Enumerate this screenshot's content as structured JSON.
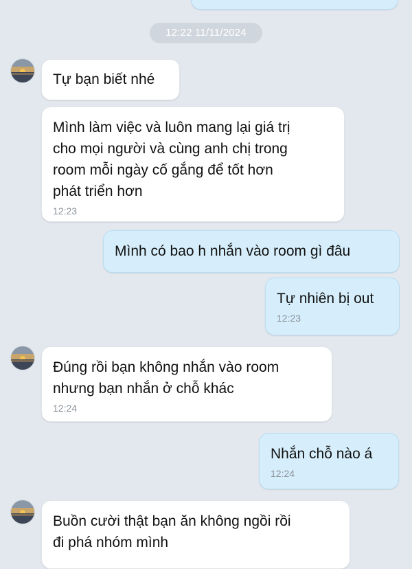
{
  "date_divider": "12:22 11/11/2024",
  "colors": {
    "background": "#e3e8ef",
    "incoming_bubble": "#ffffff",
    "outgoing_bubble": "#d6eefb",
    "timestamp": "#8c939b"
  },
  "messages": [
    {
      "direction": "incoming",
      "text": "Tự bạn biết nhé",
      "time": ""
    },
    {
      "direction": "incoming",
      "text": "Mình làm việc và luôn mang lại giá trị\ncho mọi người và cùng anh chị trong\nroom mỗi ngày cố gắng để tốt hơn\nphát triển hơn",
      "time": "12:23"
    },
    {
      "direction": "outgoing",
      "text": "Mình có bao h nhắn vào room gì đâu",
      "time": ""
    },
    {
      "direction": "outgoing",
      "text": "Tự nhiên bị out",
      "time": "12:23"
    },
    {
      "direction": "incoming",
      "text": "Đúng rồi bạn không nhắn vào room\nnhưng bạn nhắn ở chỗ khác",
      "time": "12:24"
    },
    {
      "direction": "outgoing",
      "text": "Nhắn chỗ nào á",
      "time": "12:24"
    },
    {
      "direction": "incoming",
      "text": "Buồn cười thật bạn ăn không ngồi rồi\nđi phá nhóm mình",
      "time": ""
    }
  ]
}
